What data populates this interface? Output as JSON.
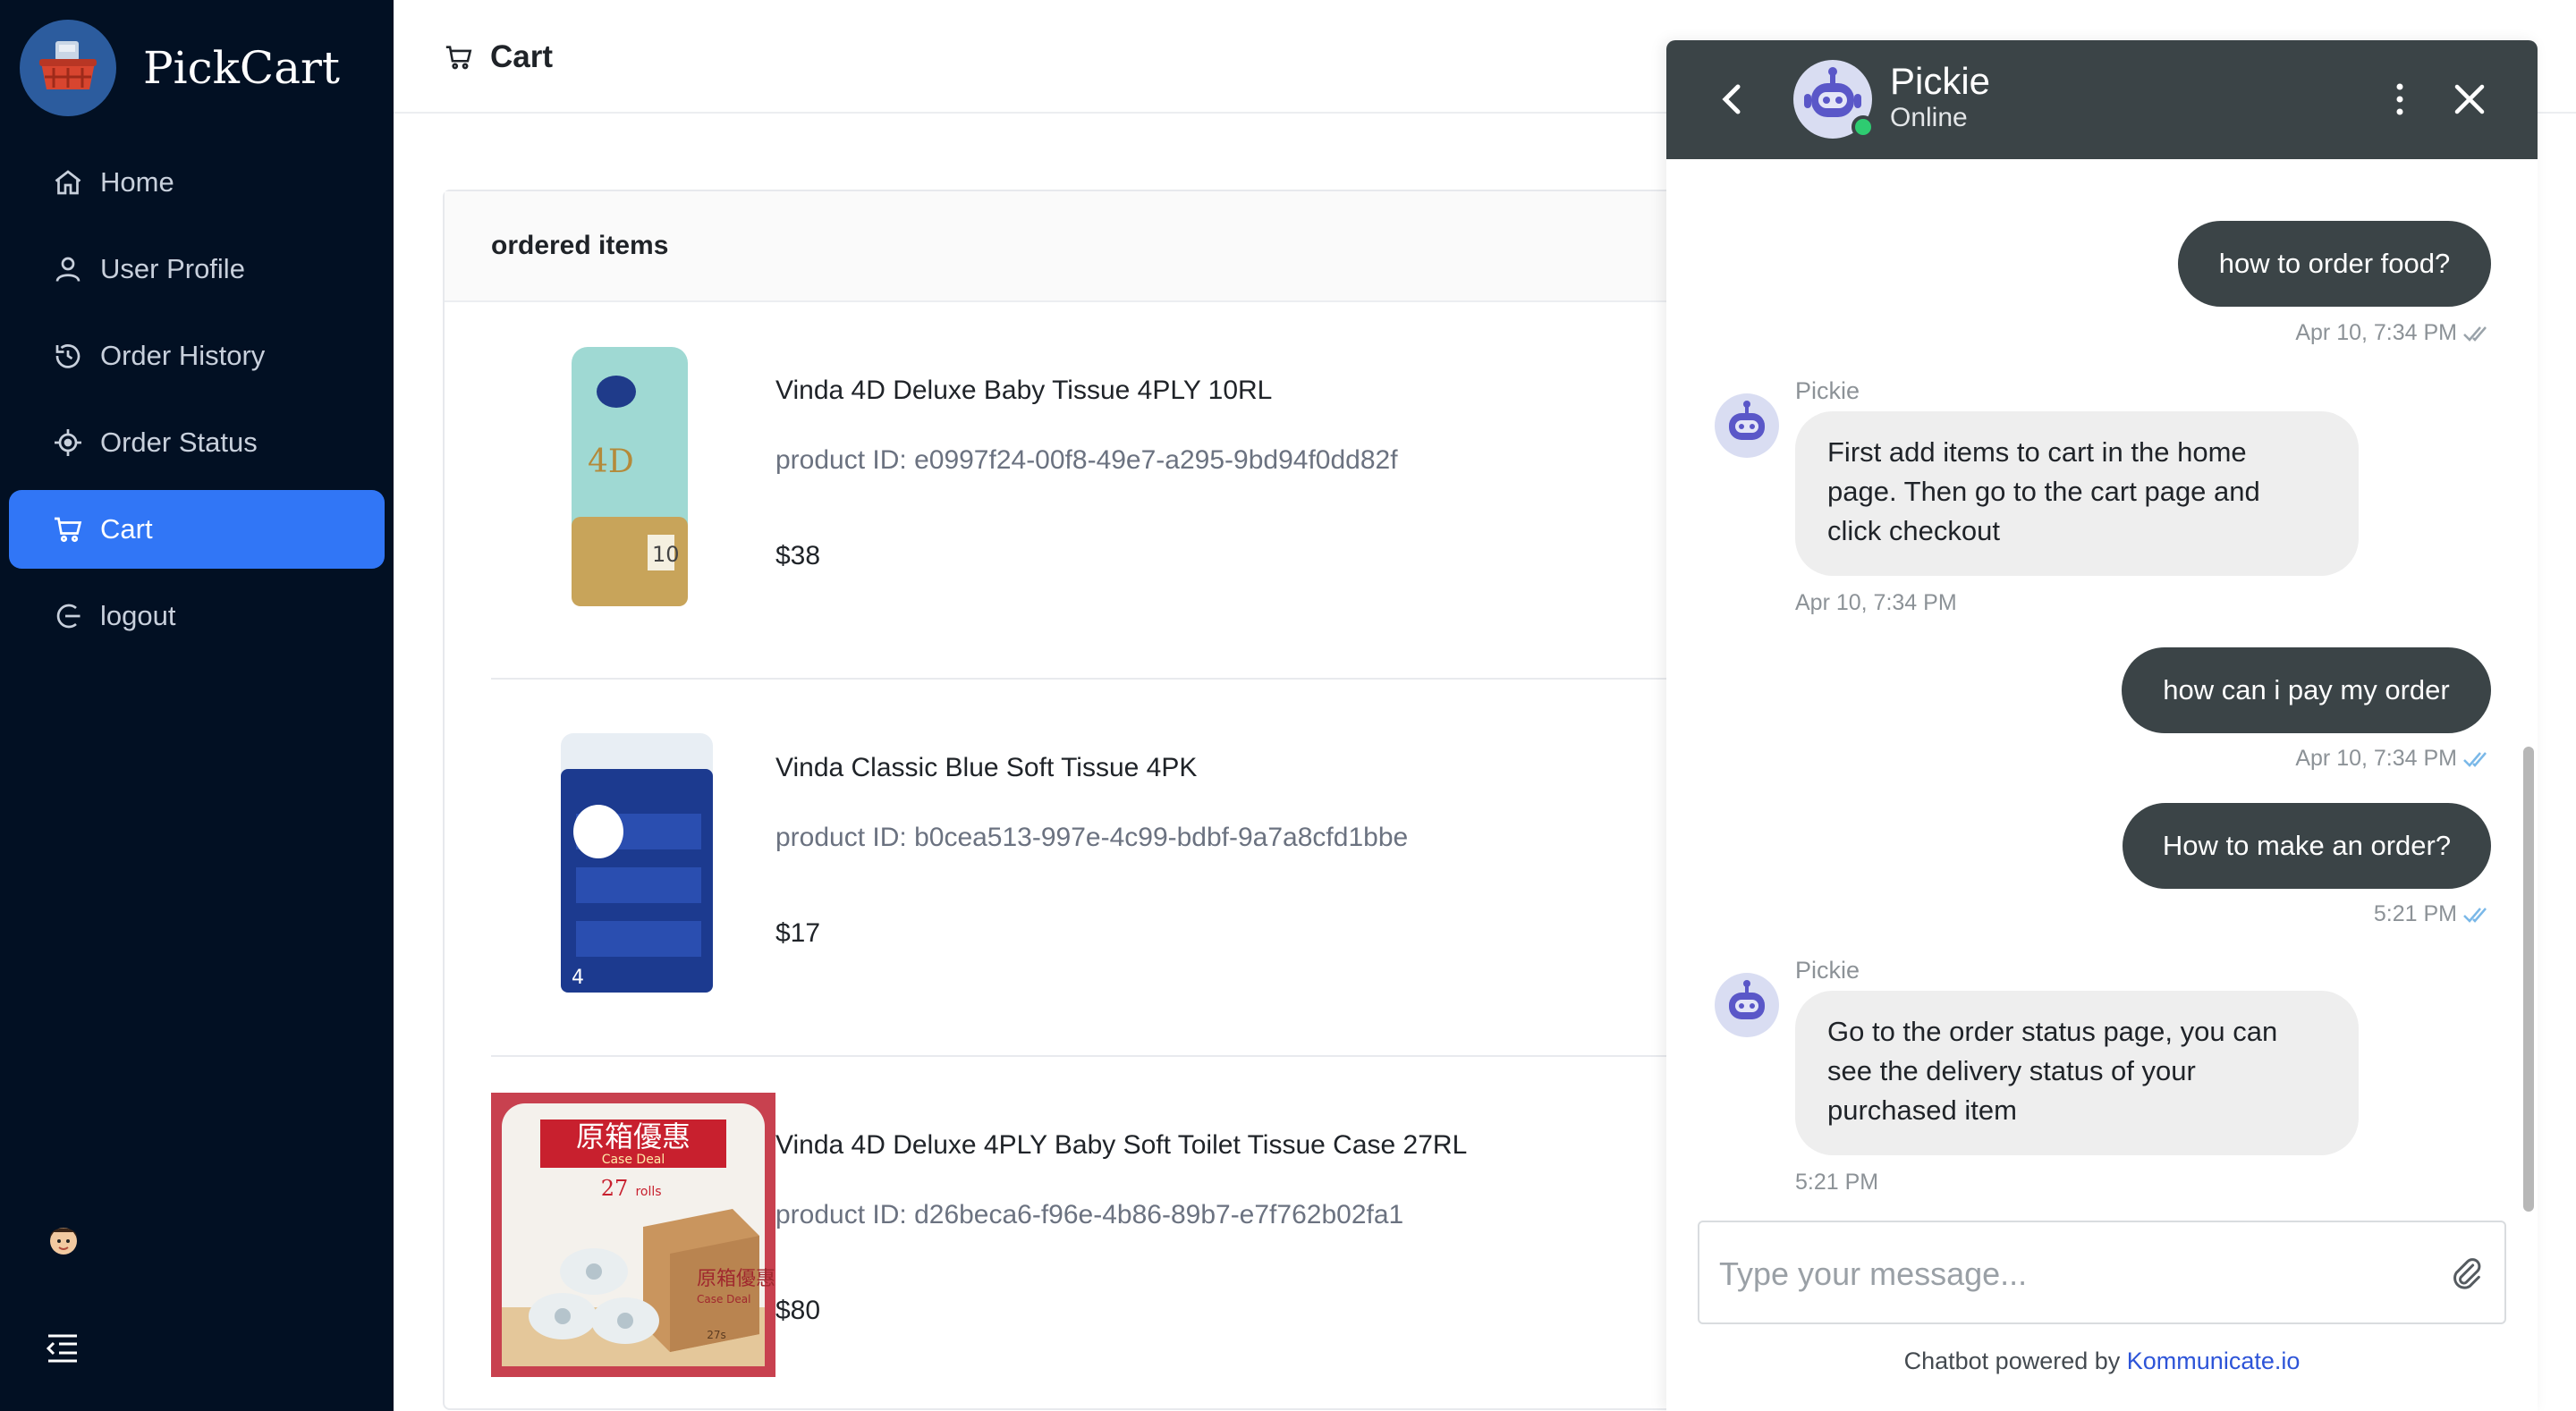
{
  "app": {
    "title": "PickCart"
  },
  "sidebar": {
    "items": [
      {
        "label": "Home",
        "icon": "home-icon"
      },
      {
        "label": "User Profile",
        "icon": "user-icon"
      },
      {
        "label": "Order History",
        "icon": "history-icon"
      },
      {
        "label": "Order Status",
        "icon": "target-icon"
      },
      {
        "label": "Cart",
        "icon": "cart-icon",
        "active": true
      },
      {
        "label": "logout",
        "icon": "logout-icon"
      }
    ],
    "active_color": "#3176f6",
    "background": "#021023"
  },
  "header": {
    "title": "Cart"
  },
  "cart": {
    "section_title": "ordered items",
    "items": [
      {
        "name": "Vinda 4D Deluxe Baby Tissue 4PLY 10RL",
        "product_id": "product ID: e0997f24-00f8-49e7-a295-9bd94f0dd82f",
        "price": "$38"
      },
      {
        "name": "Vinda Classic Blue Soft Tissue 4PK",
        "product_id": "product ID: b0cea513-997e-4c99-bdbf-9a7a8cfd1bbe",
        "price": "$17"
      },
      {
        "name": "Vinda 4D Deluxe 4PLY Baby Soft Toilet Tissue Case 27RL",
        "product_id": "product ID: d26beca6-f96e-4b86-89b7-e7f762b02fa1",
        "price": "$80",
        "image_text": {
          "banner": "原箱優惠",
          "banner_sub": "Case Deal",
          "count": "27",
          "count_unit": "rolls",
          "box_label": "原箱優惠",
          "box_sub": "Case Deal",
          "box_count": "27s"
        }
      }
    ]
  },
  "chat": {
    "bot_name": "Pickie",
    "status": "Online",
    "messages": [
      {
        "from": "user",
        "text": "how to order food?",
        "time": "Apr 10, 7:34 PM"
      },
      {
        "from": "bot",
        "sender": "Pickie",
        "lines": [
          "First add items to cart in the home",
          "page. Then go to the cart page and",
          "click checkout"
        ],
        "time": "Apr 10, 7:34 PM"
      },
      {
        "from": "user",
        "text": "how can i pay my order",
        "time": "Apr 10, 7:34 PM"
      },
      {
        "from": "user",
        "text": "How to make an order?",
        "time": "5:21 PM"
      },
      {
        "from": "bot",
        "sender": "Pickie",
        "lines": [
          "Go to the order status page, you can",
          "see the delivery status of your",
          "purchased item"
        ],
        "time": "5:21 PM"
      }
    ],
    "input_placeholder": "Type your message...",
    "powered_by": "Chatbot powered by",
    "powered_link": "Kommunicate.io",
    "header_color": "#3b4447",
    "read_tick_color": "#7ab8e8"
  }
}
